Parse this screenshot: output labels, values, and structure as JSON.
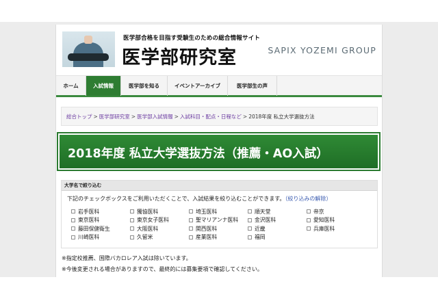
{
  "header": {
    "tagline": "医学部合格を目指す受験生のための総合情報サイト",
    "logo": "医学部研究室",
    "group": "SAPIX YOZEMI GROUP"
  },
  "nav": [
    {
      "label": "ホーム",
      "active": false
    },
    {
      "label": "入試情報",
      "active": true
    },
    {
      "label": "医学部を知る",
      "active": false
    },
    {
      "label": "イベントアーカイブ",
      "active": false
    },
    {
      "label": "医学部生の声",
      "active": false
    }
  ],
  "breadcrumb": {
    "items": [
      "総合トップ",
      "医学部研究室",
      "医学部入試情報",
      "入試科目・配点・日程など"
    ],
    "current": "2018年度 私立大学選抜方法",
    "separator": ">"
  },
  "page_title": "2018年度 私立大学選抜方法（推薦・AO入試）",
  "filter": {
    "heading": "大学名で絞り込む",
    "description": "下記のチェックボックスをご利用いただくことで、入試結果を絞り込むことができます。",
    "reset_label": "（絞り込みの解除）",
    "universities": [
      "岩手医科",
      "獨協医科",
      "埼玉医科",
      "順天堂",
      "帝京",
      "東京医科",
      "東京女子医科",
      "聖マリアンナ医科",
      "金沢医科",
      "愛知医科",
      "藤田保健衛生",
      "大阪医科",
      "関西医科",
      "近畿",
      "兵庫医科",
      "川崎医科",
      "久留米",
      "産業医科",
      "福岡"
    ]
  },
  "notes": [
    "※指定校推薦、国際バカロレア入試は除いています。",
    "※今後変更される場合がありますので、最終的には募集要項で確認してください。"
  ],
  "colors": {
    "brand_green": "#2e7d32",
    "link_purple": "#6a3aa0",
    "reset_blue": "#3a5bb0"
  }
}
